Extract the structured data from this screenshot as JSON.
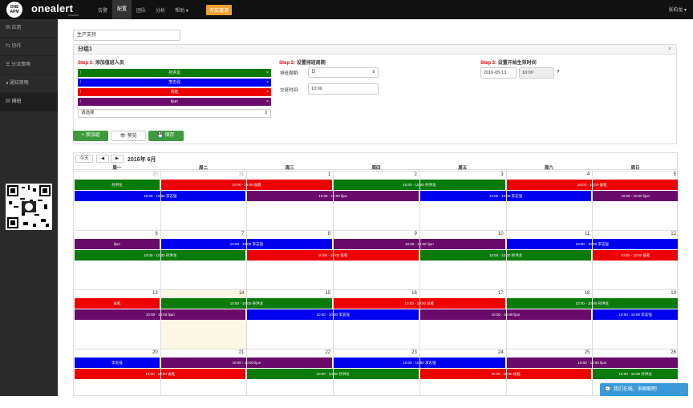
{
  "topbar": {
    "logo_text": "ONE APM",
    "brand": "onealert",
    "brand_sub": "ONEAPM",
    "nav": [
      "告警",
      "配置",
      "团队",
      "分析",
      "帮助 ▾"
    ],
    "invite": "有奖邀请",
    "user": "张伯龙 ▾"
  },
  "sidebar": {
    "items": [
      "应用",
      "协作",
      "分派策略",
      "通知策略",
      "排班"
    ]
  },
  "form": {
    "schedule_name": "生产支持",
    "group_title": "分组1",
    "step1_prefix": "Step 1:",
    "step1_label": "添加值班人员",
    "step2_prefix": "Step 2:",
    "step2_label": "设置排班周期",
    "step3_prefix": "Step 3:",
    "step3_label": "设置开始生效时间",
    "members": [
      {
        "name": "孙洪龙",
        "color": "#0a7a0a"
      },
      {
        "name": "李志强",
        "color": "#0000ee"
      },
      {
        "name": "侯乾",
        "color": "#ee0000"
      },
      {
        "name": "lijun",
        "color": "#6a0a6a"
      }
    ],
    "member_select": "请选择",
    "cycle_label": "排班周期:",
    "cycle_value": "日",
    "shift_label": "交班时间:",
    "shift_value": "10:00",
    "start_date": "2016-05-13",
    "start_time": "10:00",
    "help_icon": "?"
  },
  "actions": {
    "add_group": "+ 添加组",
    "preview": "👁 预览",
    "save": "💾 保存"
  },
  "calendar": {
    "today_btn": "今天",
    "prev": "◀",
    "next": "▶",
    "title": "2016年 6月",
    "weekdays": [
      "周一",
      "周二",
      "周三",
      "周四",
      "周五",
      "周六",
      "周日"
    ]
  },
  "chat": {
    "text": "我们在线，来聊聊吧"
  }
}
